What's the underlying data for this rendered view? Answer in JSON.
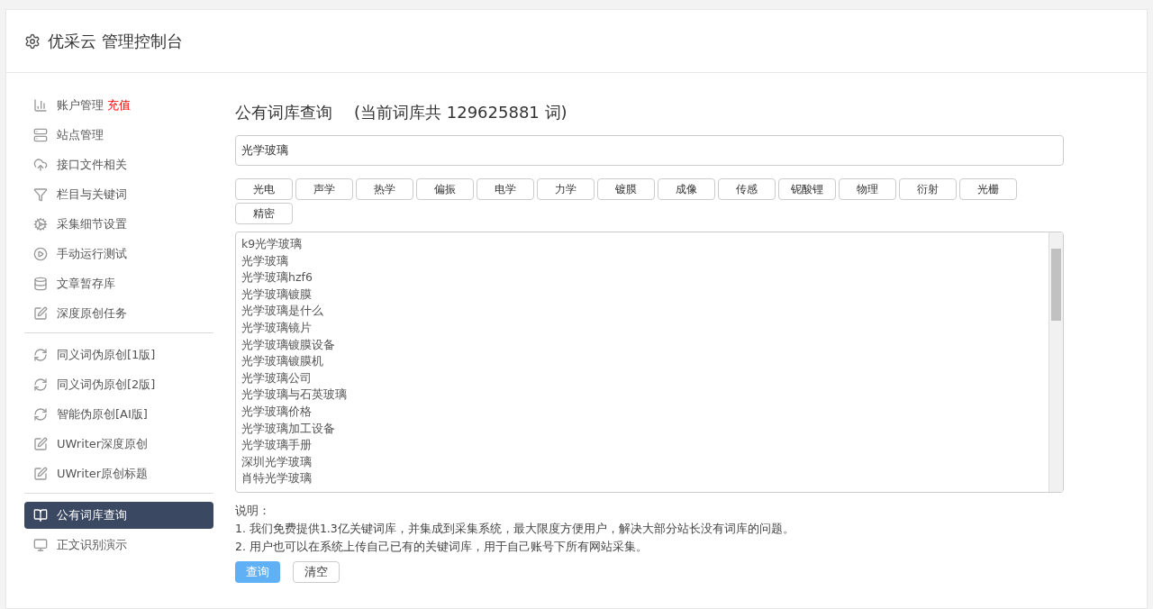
{
  "header": {
    "title": "优采云 管理控制台"
  },
  "sidebar": {
    "groups": [
      [
        {
          "kind": "chart",
          "label": "账户管理",
          "badge": "充值",
          "selected": false
        },
        {
          "kind": "server",
          "label": "站点管理",
          "selected": false
        },
        {
          "kind": "cloud",
          "label": "接口文件相关",
          "selected": false
        },
        {
          "kind": "filter",
          "label": "栏目与关键词",
          "selected": false
        },
        {
          "kind": "gears",
          "label": "采集细节设置",
          "selected": false
        },
        {
          "kind": "play",
          "label": "手动运行测试",
          "selected": false
        },
        {
          "kind": "database",
          "label": "文章暂存库",
          "selected": false
        },
        {
          "kind": "edit",
          "label": "深度原创任务",
          "selected": false
        }
      ],
      [
        {
          "kind": "refresh",
          "label": "同义词伪原创[1版]",
          "selected": false
        },
        {
          "kind": "refresh",
          "label": "同义词伪原创[2版]",
          "selected": false
        },
        {
          "kind": "refresh",
          "label": "智能伪原创[AI版]",
          "selected": false
        },
        {
          "kind": "edit",
          "label": "UWriter深度原创",
          "selected": false
        },
        {
          "kind": "edit",
          "label": "UWriter原创标题",
          "selected": false
        }
      ],
      [
        {
          "kind": "book",
          "label": "公有词库查询",
          "selected": true
        },
        {
          "kind": "monitor",
          "label": "正文识别演示",
          "selected": false
        }
      ]
    ]
  },
  "main": {
    "title": "公有词库查询",
    "count": "(当前词库共 129625881 词)",
    "search": {
      "value": "光学玻璃"
    },
    "tags": [
      "光电",
      "声学",
      "热学",
      "偏振",
      "电学",
      "力学",
      "镀膜",
      "成像",
      "传感",
      "铌酸锂",
      "物理",
      "衍射",
      "光栅",
      "精密"
    ],
    "results": [
      "k9光学玻璃",
      "光学玻璃",
      "光学玻璃hzf6",
      "光学玻璃镀膜",
      "光学玻璃是什么",
      "光学玻璃镜片",
      "光学玻璃镀膜设备",
      "光学玻璃镀膜机",
      "光学玻璃公司",
      "光学玻璃与石英玻璃",
      "光学玻璃价格",
      "光学玻璃加工设备",
      "光学玻璃手册",
      "深圳光学玻璃",
      "肖特光学玻璃"
    ],
    "notes_title": "说明：",
    "notes": [
      "1. 我们免费提供1.3亿关键词库，并集成到采集系统，最大限度方便用户，解决大部分站长没有词库的问题。",
      "2. 用户也可以在系统上传自己已有的关键词库，用于自己账号下所有网站采集。"
    ],
    "buttons": [
      {
        "kind": "primary",
        "label": "查询"
      },
      {
        "kind": "default",
        "label": "清空"
      }
    ]
  }
}
